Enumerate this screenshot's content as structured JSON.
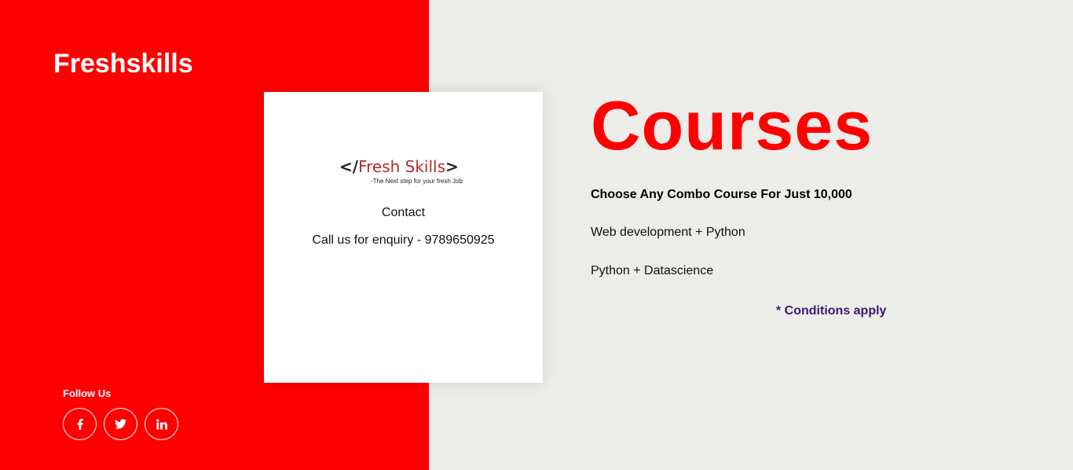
{
  "brand": {
    "name": "Freshskills"
  },
  "social": {
    "heading": "Follow Us",
    "icons": [
      "facebook-icon",
      "twitter-icon",
      "linkedin-icon"
    ]
  },
  "contact_card": {
    "logo": {
      "bracket_open": "</",
      "name": "Fresh Skills",
      "bracket_close": ">",
      "tagline": "-The Next step for your fresh Job"
    },
    "heading": "Contact",
    "phone_text": "Call us for enquiry - 9789650925"
  },
  "courses": {
    "title": "Courses",
    "offer": "Choose Any Combo Course For Just 10,000",
    "combos": [
      "Web development + Python",
      "Python + Datascience"
    ],
    "conditions": "* Conditions apply"
  },
  "colors": {
    "brand_red": "#ff0000",
    "background": "#ecece8",
    "card": "#ffffff",
    "conditions": "#3a1c6e",
    "logo_name": "#b52a24"
  }
}
